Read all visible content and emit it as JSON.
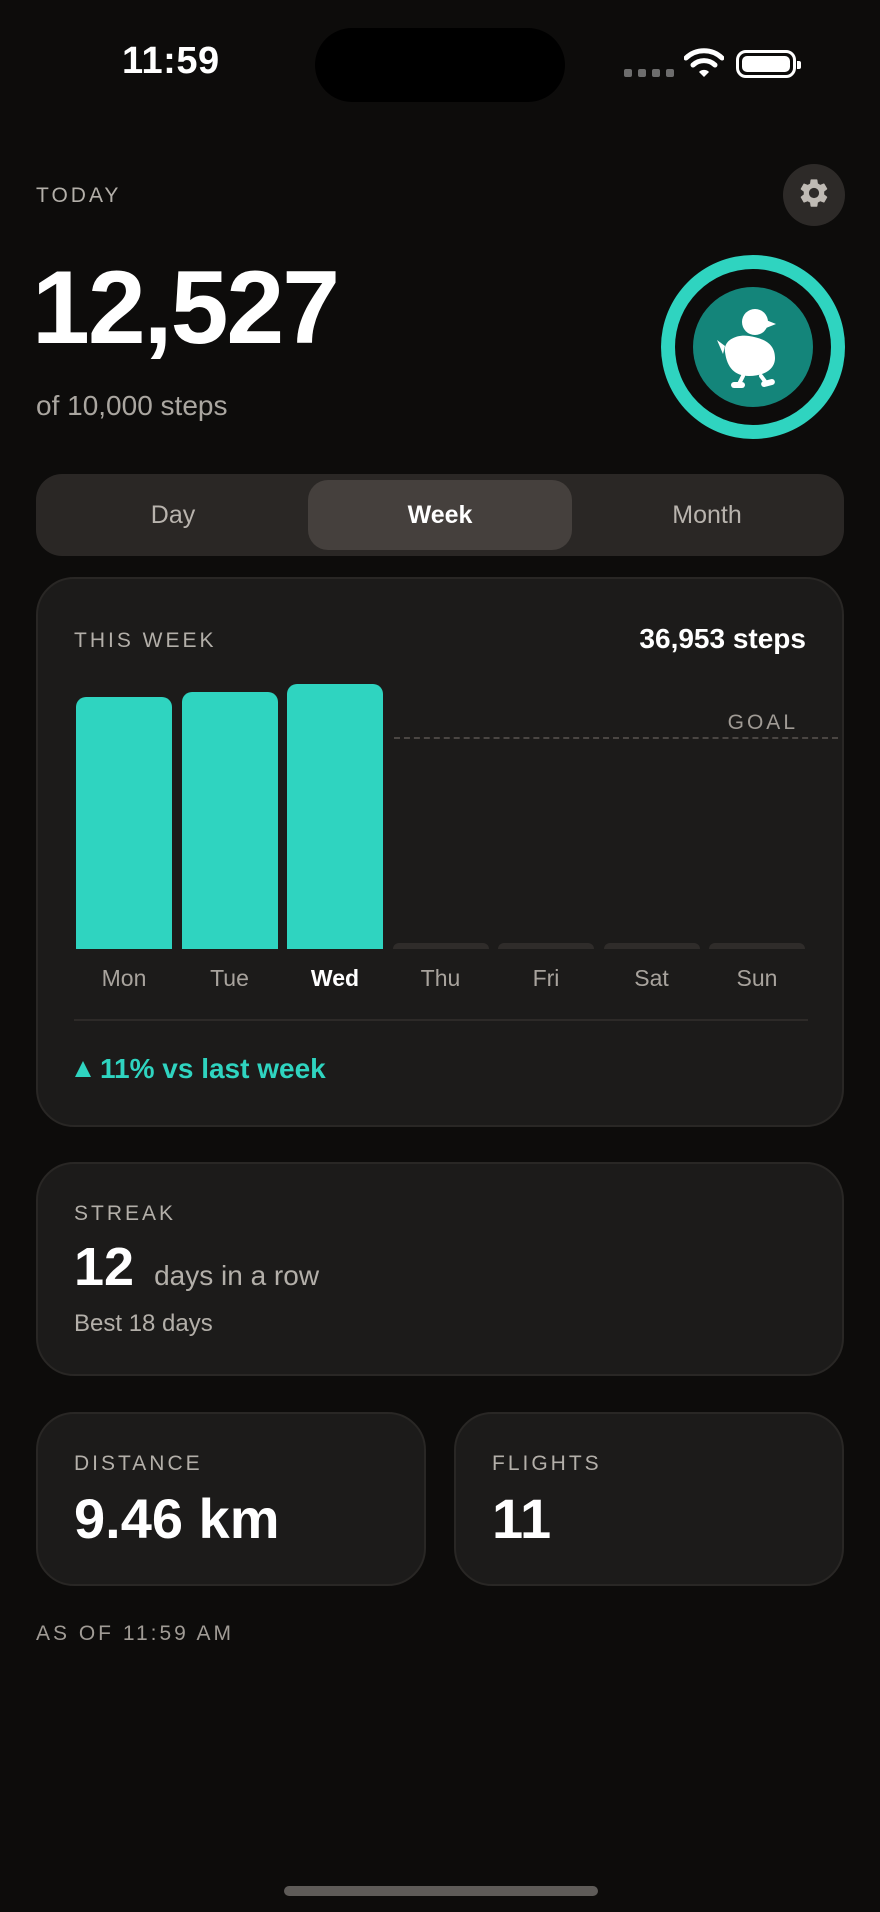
{
  "status_bar": {
    "time": "11:59"
  },
  "header": {
    "period_label": "TODAY",
    "steps": "12,527",
    "goal_text": "of 10,000 steps",
    "goal_progress": 1.0
  },
  "tabs": [
    {
      "label": "Day",
      "active": false
    },
    {
      "label": "Week",
      "active": true
    },
    {
      "label": "Month",
      "active": false
    }
  ],
  "week_card": {
    "title": "THIS WEEK",
    "total": "36,953 steps",
    "goal_label": "GOAL",
    "trend": "11% vs last week",
    "colors": {
      "bar": "#2fd4c0",
      "empty_bar": "#2f2c2a"
    },
    "chart_data": {
      "type": "bar",
      "categories": [
        "Mon",
        "Tue",
        "Wed",
        "Thu",
        "Fri",
        "Sat",
        "Sun"
      ],
      "values": [
        11900,
        12100,
        12500,
        0,
        0,
        0,
        0
      ],
      "goal": 10000,
      "current_day": "Wed"
    }
  },
  "streak": {
    "label": "STREAK",
    "value": "12",
    "unit": "days in a row",
    "best": "Best 18 days"
  },
  "distance": {
    "label": "DISTANCE",
    "value": "9.46 km"
  },
  "flights": {
    "label": "FLIGHTS",
    "value": "11"
  },
  "footer": {
    "as_of": "AS OF 11:59 AM"
  },
  "icons": {
    "settings": "gear-icon",
    "mascot": "duck-icon",
    "trend": "triangle-up-icon"
  },
  "accent_color": "#2fd4c0"
}
